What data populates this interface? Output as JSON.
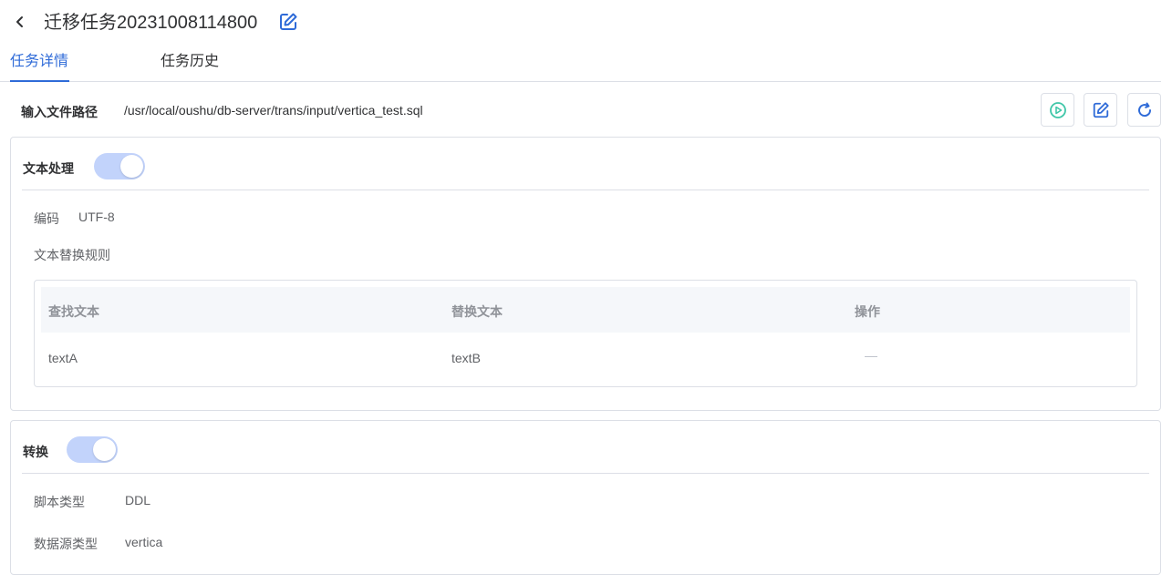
{
  "header": {
    "title": "迁移任务20231008114800"
  },
  "tabs": [
    {
      "label": "任务详情",
      "active": true
    },
    {
      "label": "任务历史",
      "active": false
    }
  ],
  "input_path": {
    "label": "输入文件路径",
    "value": "/usr/local/oushu/db-server/trans/input/vertica_test.sql"
  },
  "text_processing": {
    "title": "文本处理",
    "enabled": true,
    "encoding_label": "编码",
    "encoding_value": "UTF-8",
    "rules_label": "文本替换规则",
    "table": {
      "headers": [
        "查找文本",
        "替换文本",
        "操作"
      ],
      "rows": [
        {
          "find": "textA",
          "replace": "textB",
          "action": ""
        }
      ]
    }
  },
  "conversion": {
    "title": "转换",
    "enabled": true,
    "script_type_label": "脚本类型",
    "script_type_value": "DDL",
    "datasource_label": "数据源类型",
    "datasource_value": "vertica"
  },
  "colors": {
    "accent": "#2f6bd8",
    "run_icon": "#3fc6a8",
    "switch_on": "#c2d3fb",
    "border": "#dcdfe6"
  },
  "icons": {
    "back": "chevron-left-icon",
    "title_edit": "edit-icon",
    "run": "play-circle-icon",
    "edit": "edit-icon",
    "refresh": "refresh-icon"
  }
}
